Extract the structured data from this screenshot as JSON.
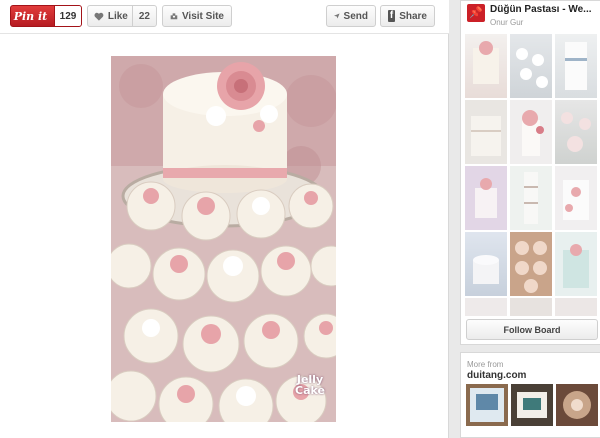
{
  "toolbar": {
    "pin_label": "Pin it",
    "pin_count": "129",
    "like_label": "Like",
    "like_count": "22",
    "visit_label": "Visit Site",
    "send_label": "Send",
    "share_label": "Share"
  },
  "photo": {
    "watermark_line1": "Jelly",
    "watermark_line2": "Cake"
  },
  "board": {
    "title": "Düğün Pastası - We...",
    "user": "Onur Gur",
    "follow_label": "Follow Board"
  },
  "more": {
    "label": "More from",
    "site": "duitang.com"
  },
  "colors": {
    "pin_red": "#cb2027",
    "cake_pink": "#e8a9ad",
    "cake_cream": "#f6f0e6"
  }
}
